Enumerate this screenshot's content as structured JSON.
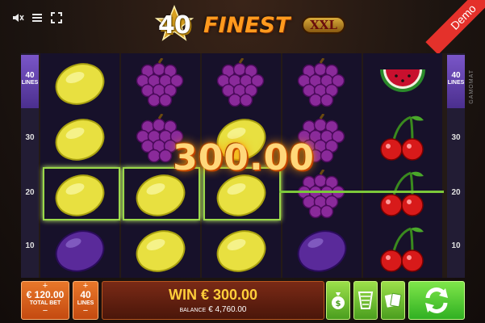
{
  "header": {
    "logo_number": "40",
    "logo_word": "FINEST",
    "logo_badge": "XXL",
    "demo_label": "Demo",
    "icons": [
      "sound-icon",
      "menu-icon",
      "fullscreen-icon"
    ]
  },
  "paylines": {
    "top_value": "40",
    "top_label": "LINES",
    "markers": [
      "30",
      "20",
      "10"
    ]
  },
  "reels": [
    [
      "lemon",
      "lemon",
      "lemon",
      "plum"
    ],
    [
      "grapes",
      "grapes",
      "lemon",
      "lemon"
    ],
    [
      "grapes",
      "lemon",
      "lemon",
      "lemon"
    ],
    [
      "grapes",
      "grapes",
      "grapes",
      "plum"
    ],
    [
      "watermelon",
      "cherries",
      "cherries",
      "cherries"
    ]
  ],
  "vendor_text": "GAMOMAT",
  "win_display": "300.00",
  "bottom": {
    "plus": "+",
    "minus": "−",
    "total_bet_value": "€ 120.00",
    "total_bet_label": "TOTAL BET",
    "lines_value": "40",
    "lines_label": "LINES",
    "win_text": "WIN € 300.00",
    "balance_label": "BALANCE",
    "balance_value": "€ 4,760.00"
  },
  "colors": {
    "accent_orange": "#e8782a",
    "win_gold": "#ffcf3a",
    "green_button": "#4a9e1e",
    "demo_red": "#e4312b",
    "payline_green": "#7cc83a"
  }
}
